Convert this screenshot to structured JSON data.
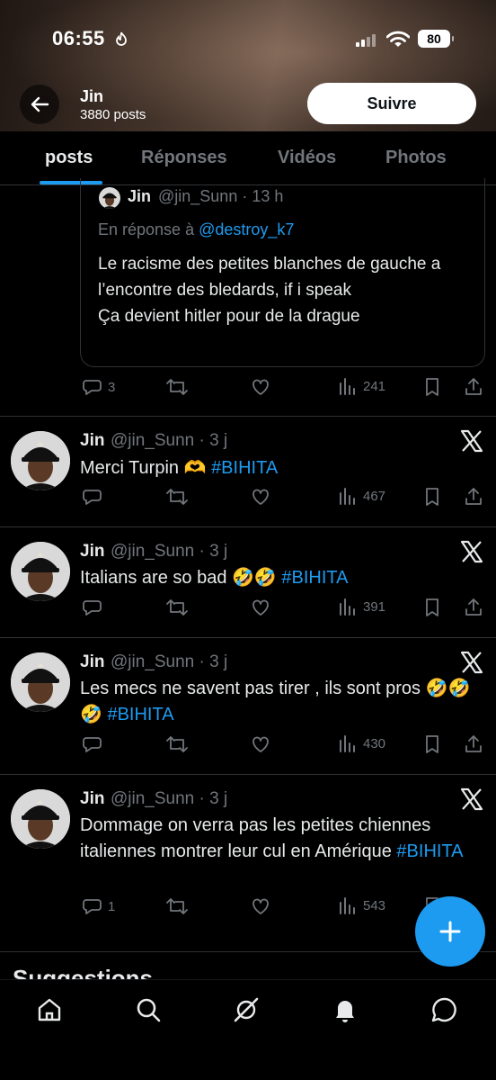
{
  "status_bar": {
    "time": "06:55",
    "battery": "80"
  },
  "header": {
    "name": "Jin",
    "posts_count": "3880 posts",
    "follow_label": "Suivre"
  },
  "tabs": [
    {
      "label": "posts",
      "active": true
    },
    {
      "label": "Réponses",
      "active": false
    },
    {
      "label": "Vidéos",
      "active": false
    },
    {
      "label": "Photos",
      "active": false
    }
  ],
  "quote": {
    "name": "Jin",
    "meta": "@jin_Sunn · 13 h",
    "reply_prefix": "En réponse à",
    "reply_to": "@destroy_k7",
    "text": "Le racisme des petites blanches de gauche a l’encontre des bledards, if i speak\nÇa devient hitler pour de la drague",
    "stats": {
      "replies": "3",
      "views": "241"
    }
  },
  "tweets": [
    {
      "name": "Jin",
      "meta": "@jin_Sunn · 3 j",
      "text": "Merci Turpin 🫶",
      "hashtag": "#BIHITA",
      "replies": "",
      "views": "467"
    },
    {
      "name": "Jin",
      "meta": "@jin_Sunn · 3 j",
      "text": "Italians are so bad 🤣🤣",
      "hashtag": "#BIHITA",
      "replies": "",
      "views": "391"
    },
    {
      "name": "Jin",
      "meta": "@jin_Sunn · 3 j",
      "text": "Les mecs ne savent pas tirer , ils sont pros 🤣🤣🤣",
      "hashtag": "#BIHITA",
      "replies": "",
      "views": "430"
    },
    {
      "name": "Jin",
      "meta": "@jin_Sunn · 3 j",
      "text": "Dommage on verra pas les petites chiennes italiennes montrer leur cul en Amérique",
      "hashtag": "#BIHITA",
      "replies": "1",
      "views": "543"
    }
  ],
  "suggestions_label": "Suggestions",
  "colors": {
    "accent": "#1d9bf0",
    "muted": "#71767b",
    "divider": "#2f3336",
    "background": "#000000"
  },
  "icons": {
    "back": "arrow-left-icon",
    "reply": "comment-icon",
    "retweet": "retweet-icon",
    "like": "heart-icon",
    "views": "bar-chart-icon",
    "bookmark": "bookmark-icon",
    "share": "share-icon",
    "x_badge": "x-logo-icon",
    "compose": "plus-icon",
    "nav": [
      "home-icon",
      "search-icon",
      "grok-icon",
      "bell-icon",
      "message-icon"
    ]
  }
}
